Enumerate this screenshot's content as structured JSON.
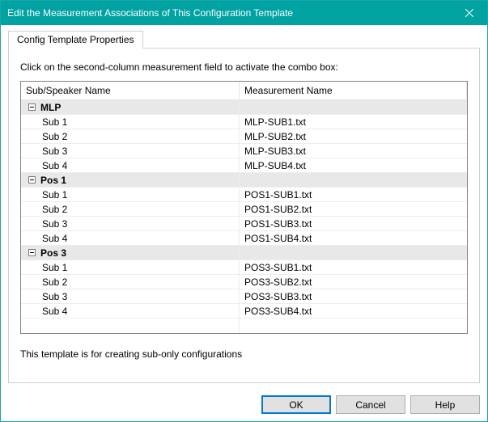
{
  "window": {
    "title": "Edit the Measurement Associations of This Configuration Template"
  },
  "tabs": {
    "active": "Config Template Properties"
  },
  "panel": {
    "instruction": "Click on the second-column measurement field to activate the combo box:",
    "footer": "This template is for creating sub-only configurations"
  },
  "grid": {
    "headers": {
      "sub": "Sub/Speaker Name",
      "meas": "Measurement Name"
    },
    "groups": [
      {
        "name": "MLP",
        "rows": [
          {
            "sub": "Sub 1",
            "meas": "MLP-SUB1.txt"
          },
          {
            "sub": "Sub 2",
            "meas": "MLP-SUB2.txt"
          },
          {
            "sub": "Sub 3",
            "meas": "MLP-SUB3.txt"
          },
          {
            "sub": "Sub 4",
            "meas": "MLP-SUB4.txt"
          }
        ]
      },
      {
        "name": "Pos 1",
        "rows": [
          {
            "sub": "Sub 1",
            "meas": "POS1-SUB1.txt"
          },
          {
            "sub": "Sub 2",
            "meas": "POS1-SUB2.txt"
          },
          {
            "sub": "Sub 3",
            "meas": "POS1-SUB3.txt"
          },
          {
            "sub": "Sub 4",
            "meas": "POS1-SUB4.txt"
          }
        ]
      },
      {
        "name": "Pos 3",
        "rows": [
          {
            "sub": "Sub 1",
            "meas": "POS3-SUB1.txt"
          },
          {
            "sub": "Sub 2",
            "meas": "POS3-SUB2.txt"
          },
          {
            "sub": "Sub 3",
            "meas": "POS3-SUB3.txt"
          },
          {
            "sub": "Sub 4",
            "meas": "POS3-SUB4.txt"
          }
        ]
      }
    ]
  },
  "buttons": {
    "ok": "OK",
    "cancel": "Cancel",
    "help": "Help"
  }
}
